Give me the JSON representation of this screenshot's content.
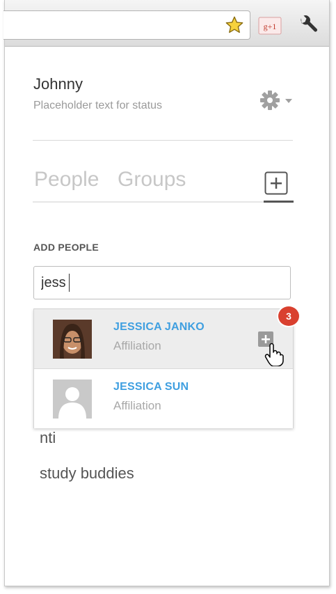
{
  "toolbar": {
    "bookmark_icon": "star-icon",
    "extension_icon": "google-plus-one-icon",
    "extension_text": "g+1",
    "menu_icon": "wrench-icon"
  },
  "profile": {
    "name": "Johnny",
    "status": "Placeholder text for status",
    "settings_icon": "gear-icon"
  },
  "tabs": [
    {
      "label": "People"
    },
    {
      "label": "Groups"
    }
  ],
  "add_group_icon": "plus-box-icon",
  "add_people": {
    "label": "ADD PEOPLE",
    "input_value": "jess"
  },
  "suggestions": [
    {
      "name": "JESSICA JANKO",
      "affiliation": "Affiliation",
      "highlighted": true
    },
    {
      "name": "JESSICA SUN",
      "affiliation": "Affiliation",
      "highlighted": false
    }
  ],
  "badge": {
    "count": "3",
    "color": "#d9402f"
  },
  "groups": [
    {
      "name": "nti"
    },
    {
      "name": "study buddies"
    }
  ],
  "colors": {
    "accent": "#3f9fe0",
    "badge": "#d9402f",
    "muted": "#c7c7c7"
  }
}
